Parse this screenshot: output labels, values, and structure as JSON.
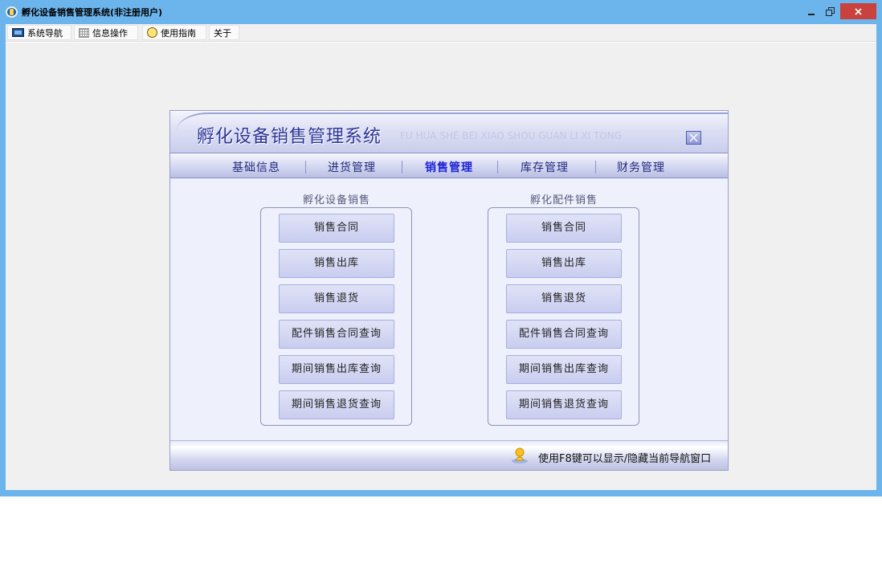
{
  "window": {
    "title": "孵化设备销售管理系统(非注册用户)"
  },
  "menu": [
    "系统导航",
    "信息操作",
    "使用指南",
    "关于"
  ],
  "panel": {
    "title": "孵化设备销售管理系统",
    "pinyin": "FU HUA SHE BEI XIAO SHOU GUAN LI XI TONG",
    "tabs": [
      "基础信息",
      "进货管理",
      "销售管理",
      "库存管理",
      "财务管理"
    ],
    "active_tab": "销售管理",
    "groups": [
      {
        "title": "孵化设备销售",
        "buttons": [
          "销售合同",
          "销售出库",
          "销售退货",
          "配件销售合同查询",
          "期间销售出库查询",
          "期间销售退货查询"
        ]
      },
      {
        "title": "孵化配件销售",
        "buttons": [
          "销售合同",
          "销售出库",
          "销售退货",
          "配件销售合同查询",
          "期间销售出库查询",
          "期间销售退货查询"
        ]
      }
    ],
    "footer_hint": "使用F8键可以显示/隐藏当前导航窗口"
  },
  "colors": {
    "title_bar": "#6cb4ec",
    "close_button": "#c9423e",
    "panel_title": "#2d3597",
    "active_tab": "#1a1fd6"
  }
}
